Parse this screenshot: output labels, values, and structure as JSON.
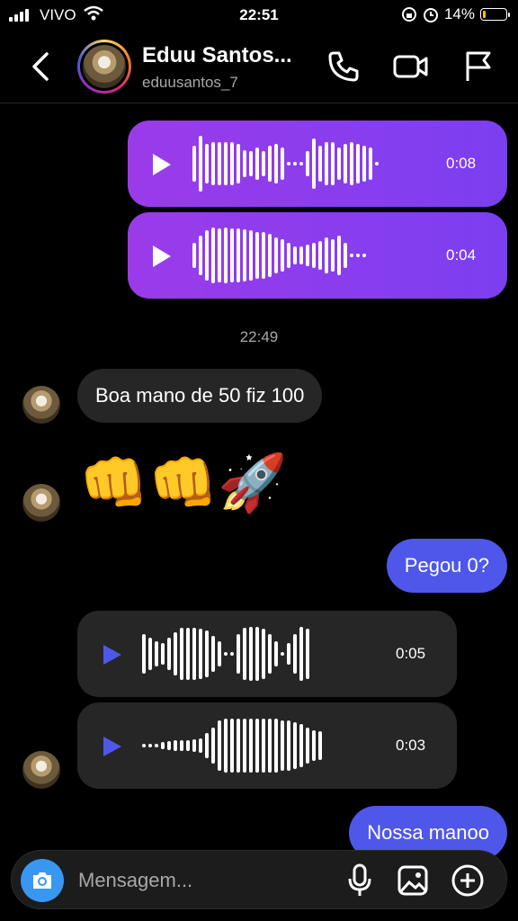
{
  "status_bar": {
    "carrier": "VIVO",
    "time": "22:51",
    "battery": "14%",
    "battery_level": 0.14,
    "battery_color": "#f5c400",
    "icons": [
      "signal-icon",
      "wifi-icon",
      "rotation-lock-icon",
      "alarm-icon",
      "battery-icon"
    ]
  },
  "header": {
    "name": "Eduu Santos...",
    "username": "eduusantos_7",
    "icons": [
      "back-chevron-icon",
      "phone-icon",
      "video-icon",
      "flag-icon"
    ]
  },
  "messages": {
    "audio1": {
      "duration": "0:08",
      "sender": "me"
    },
    "audio2": {
      "duration": "0:04",
      "sender": "me"
    },
    "timestamp": "22:49",
    "text1": {
      "text": "Boa mano de 50 fiz 100",
      "sender": "other"
    },
    "emoji": {
      "text": "👊👊🚀",
      "sender": "other"
    },
    "text2": {
      "text": "Pegou 0?",
      "sender": "me"
    },
    "audio3": {
      "duration": "0:05",
      "sender": "other"
    },
    "audio4": {
      "duration": "0:03",
      "sender": "other"
    },
    "text3": {
      "text": "Nossa manoo",
      "sender": "me"
    }
  },
  "composer": {
    "placeholder": "Mensagem...",
    "icons": [
      "camera-icon",
      "microphone-icon",
      "gallery-icon",
      "add-icon"
    ]
  },
  "colors": {
    "my_audio_bubble": "#8b3dee",
    "my_text_bubble": "#4f57ea",
    "other_bubble": "#262626",
    "play_other": "#4f57ea",
    "camera_button": "#3897f0"
  }
}
